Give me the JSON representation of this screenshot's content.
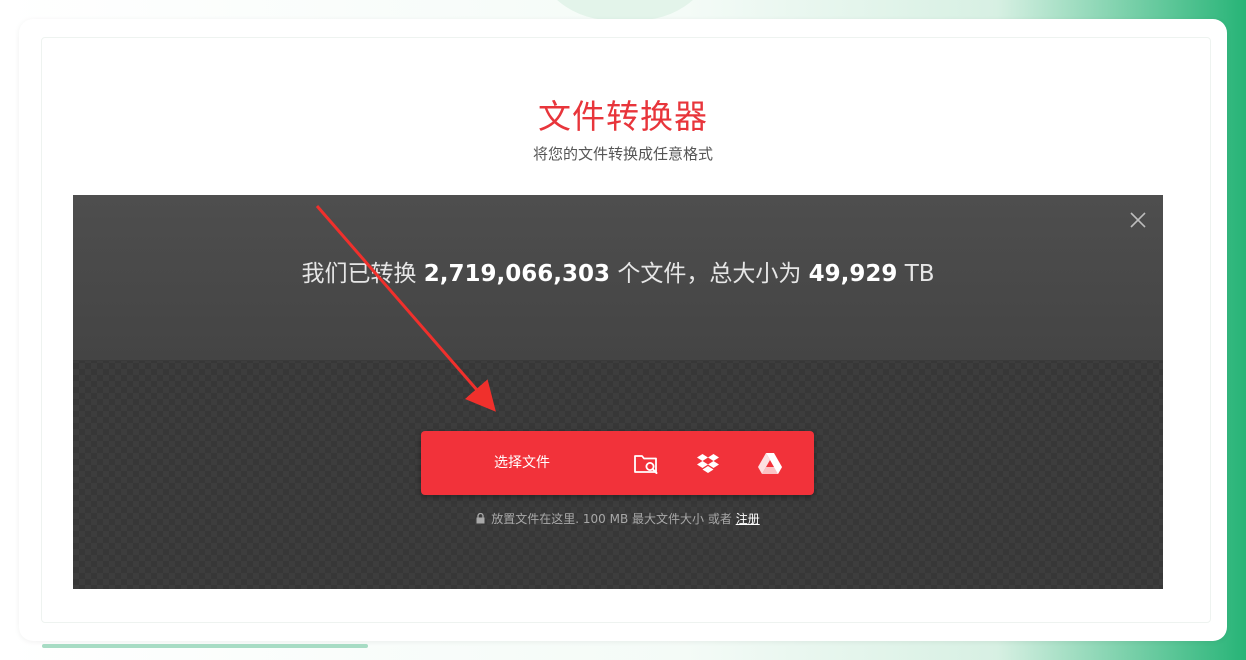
{
  "page": {
    "title": "文件转换器",
    "subtitle": "将您的文件转换成任意格式"
  },
  "stats": {
    "prefix": "我们已转换",
    "file_count": "2,719,066,303",
    "middle": "个文件，总大小为",
    "total_size": "49,929",
    "unit": "TB"
  },
  "uploader": {
    "select_label": "选择文件",
    "sources": [
      "folder-search-icon",
      "dropbox-icon",
      "google-drive-icon"
    ],
    "note_text": "放置文件在这里. 100 MB 最大文件大小 或者",
    "register_link": "注册"
  },
  "colors": {
    "accent": "#e8353b",
    "button": "#f2323a",
    "panel": "#373737",
    "brand_green": "#27b477"
  }
}
